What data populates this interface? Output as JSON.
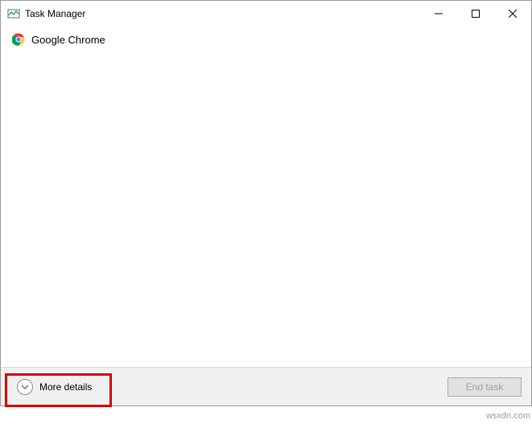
{
  "titlebar": {
    "title": "Task Manager"
  },
  "processes": [
    {
      "name": "Google Chrome"
    }
  ],
  "footer": {
    "more_details_label": "More details",
    "end_task_label": "End task"
  },
  "watermark": "wsxdn.com"
}
